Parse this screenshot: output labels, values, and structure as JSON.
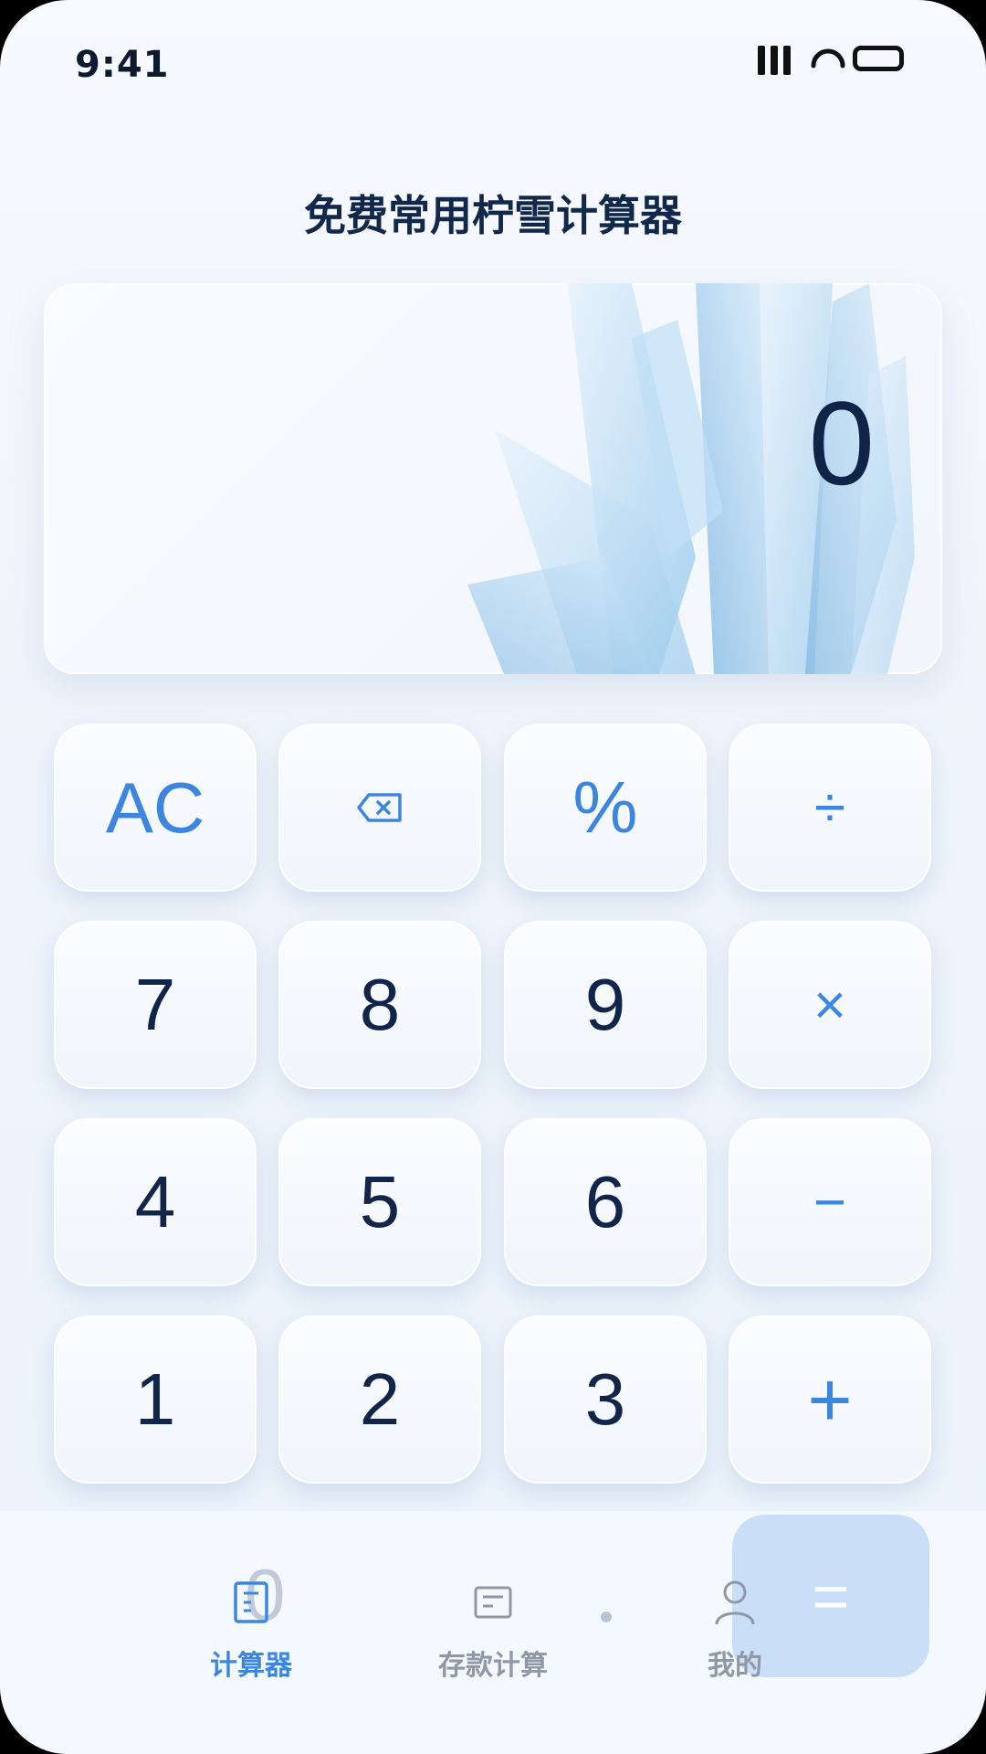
{
  "status_bar": {
    "time": "9:41"
  },
  "app": {
    "title": "免费常用柠雪计算器"
  },
  "display": {
    "value": "0"
  },
  "keypad": {
    "row1": [
      "AC",
      "",
      "%",
      "÷"
    ],
    "row2": [
      "7",
      "8",
      "9",
      "×"
    ],
    "row3": [
      "4",
      "5",
      "6",
      "−"
    ],
    "row4": [
      "1",
      "2",
      "3",
      "+"
    ],
    "equals": "="
  },
  "ghost_digit": "0",
  "nav": {
    "items": [
      {
        "label": "计算器",
        "icon": "calculator-icon",
        "active": true
      },
      {
        "label": "存款计算",
        "icon": "deposit-icon",
        "active": false
      },
      {
        "label": "我的",
        "icon": "profile-icon",
        "active": false
      }
    ]
  },
  "colors": {
    "accent": "#3c86e0",
    "digit": "#102549",
    "title": "#12284a",
    "equals_bg": "#c8dff7"
  }
}
